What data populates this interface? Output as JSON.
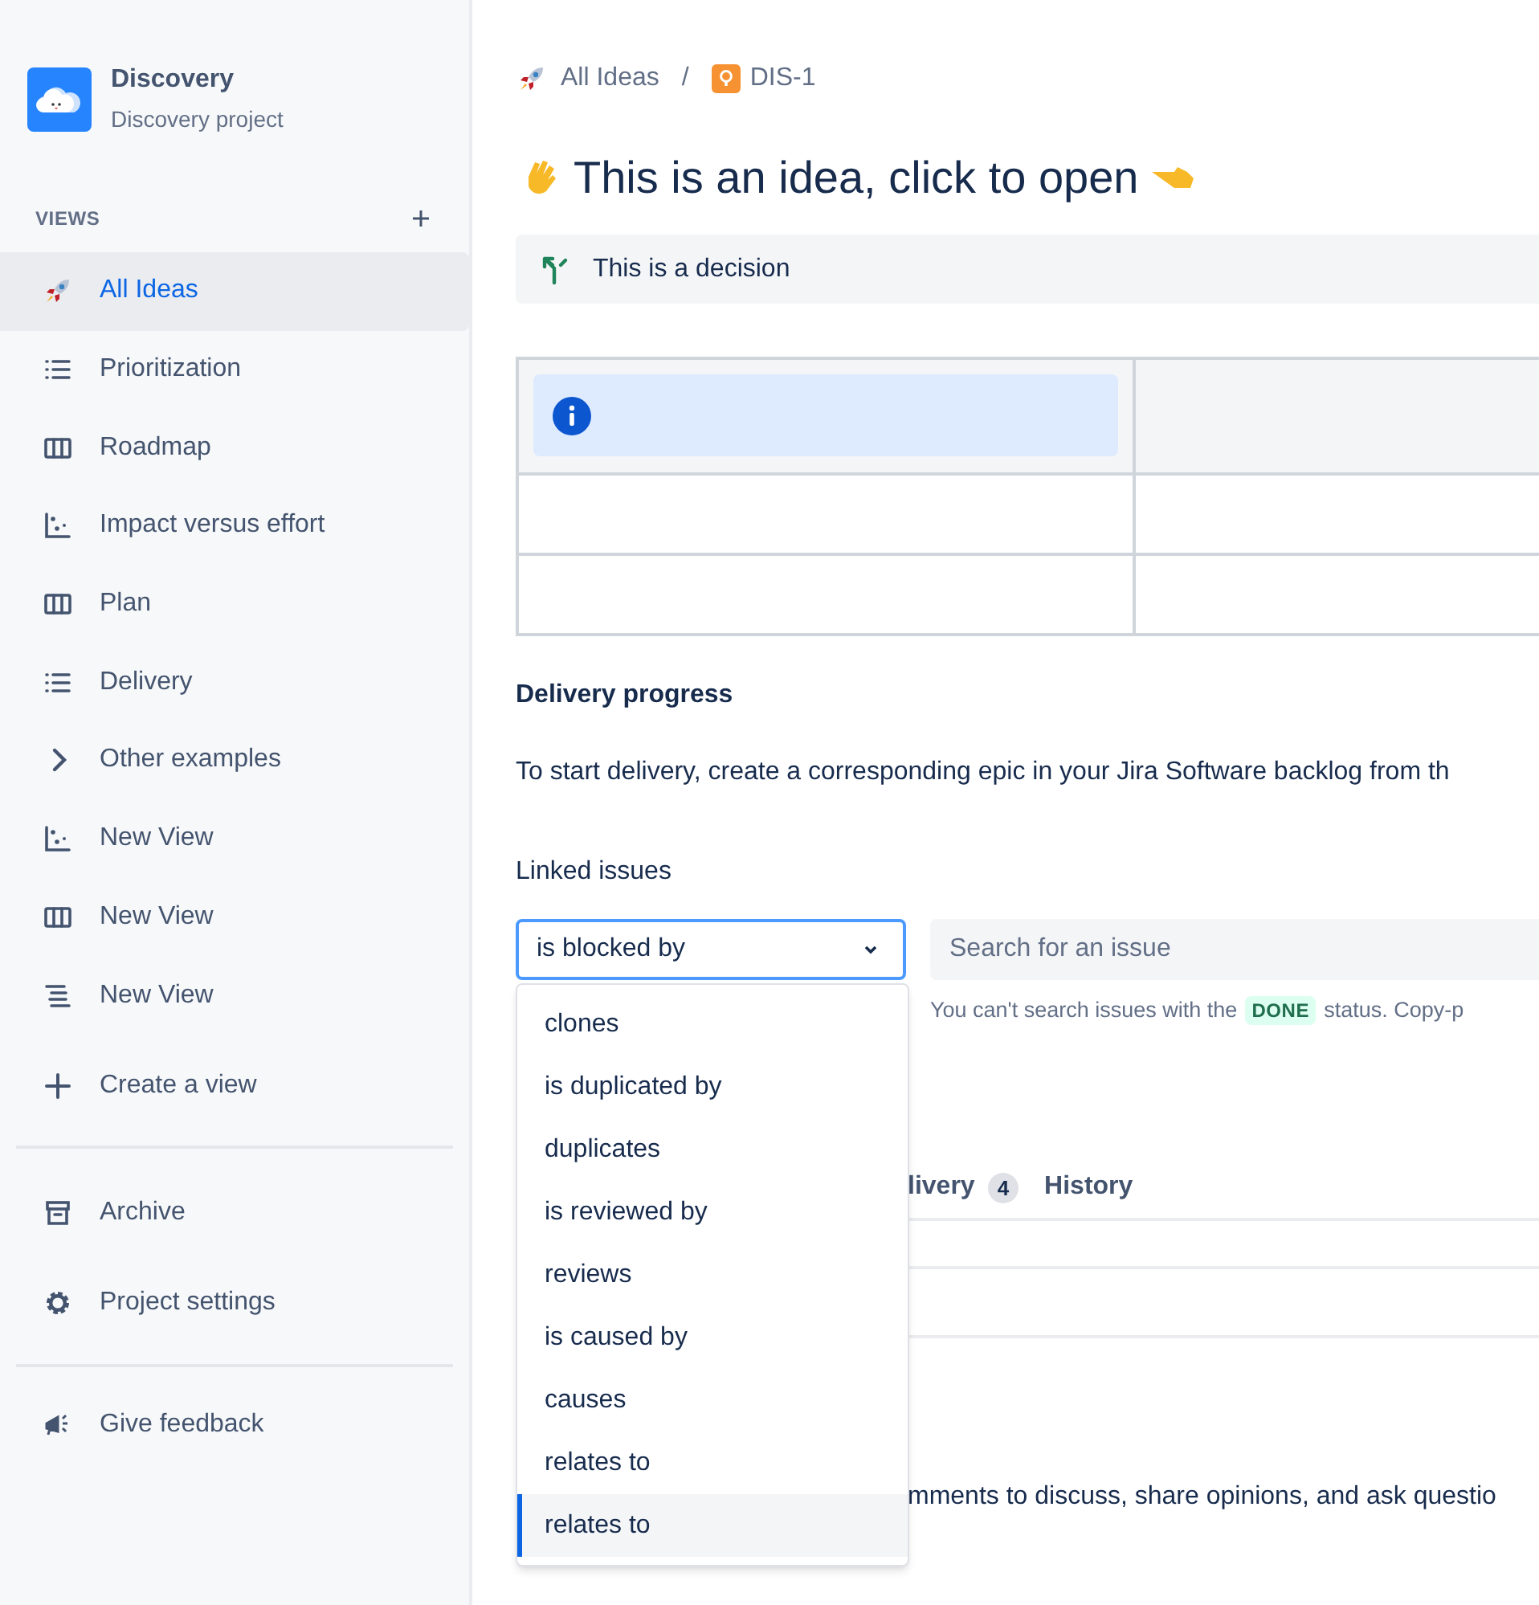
{
  "project": {
    "name": "Discovery",
    "subtitle": "Discovery project"
  },
  "views_heading": "VIEWS",
  "sidebar_items": [
    {
      "kind": "rocket",
      "label": "All Ideas",
      "selected": true
    },
    {
      "kind": "list",
      "label": "Prioritization",
      "selected": false
    },
    {
      "kind": "board",
      "label": "Roadmap",
      "selected": false
    },
    {
      "kind": "matrix",
      "label": "Impact versus effort",
      "selected": false
    },
    {
      "kind": "board",
      "label": "Plan",
      "selected": false
    },
    {
      "kind": "list",
      "label": "Delivery",
      "selected": false
    },
    {
      "kind": "chevron",
      "label": "Other examples",
      "selected": false
    },
    {
      "kind": "matrix",
      "label": "New View",
      "selected": false
    },
    {
      "kind": "board",
      "label": "New View",
      "selected": false
    },
    {
      "kind": "timeline",
      "label": "New View",
      "selected": false
    },
    {
      "kind": "plus",
      "label": "Create a view",
      "selected": false
    }
  ],
  "sidebar_footer": [
    {
      "kind": "archive",
      "label": "Archive"
    },
    {
      "kind": "gear",
      "label": "Project settings"
    }
  ],
  "feedback": "Give feedback",
  "breadcrumb": {
    "parent": "All Ideas",
    "separator": "/",
    "issue": "DIS-1"
  },
  "title": "This is an idea, click to open",
  "decision": "This is a decision",
  "table": {
    "rows": [
      {
        "kind": "header",
        "cells": [
          {
            "kind": "info"
          },
          {
            "kind": "empty"
          }
        ]
      },
      {
        "kind": "body",
        "cells": [
          {
            "kind": "empty"
          },
          {
            "kind": "empty"
          }
        ]
      },
      {
        "kind": "body",
        "cells": [
          {
            "kind": "empty"
          },
          {
            "kind": "empty"
          }
        ]
      }
    ]
  },
  "delivery_heading": "Delivery progress",
  "delivery_text": "To start delivery, create a corresponding epic in your Jira Software backlog from th",
  "linked_issues_label": "Linked issues",
  "link_type_select": {
    "value": "is blocked by",
    "expanded": true
  },
  "issue_search": {
    "placeholder": "Search for an issue"
  },
  "hint": {
    "before": "You can't search issues with the",
    "badge": "DONE",
    "after": "status. Copy-p"
  },
  "tabs": [
    {
      "label": "livery",
      "count": "4",
      "selected": false
    },
    {
      "label": "History",
      "selected": false
    }
  ],
  "comment_hint": "mments to discuss, share opinions, and ask questio",
  "dropdown_options": [
    {
      "label": "clones",
      "selected": false
    },
    {
      "label": "is duplicated by",
      "selected": false
    },
    {
      "label": "duplicates",
      "selected": false
    },
    {
      "label": "is reviewed by",
      "selected": false
    },
    {
      "label": "reviews",
      "selected": false
    },
    {
      "label": "is caused by",
      "selected": false
    },
    {
      "label": "causes",
      "selected": false
    },
    {
      "label": "relates to",
      "selected": false
    },
    {
      "label": "relates to",
      "selected": true
    }
  ]
}
